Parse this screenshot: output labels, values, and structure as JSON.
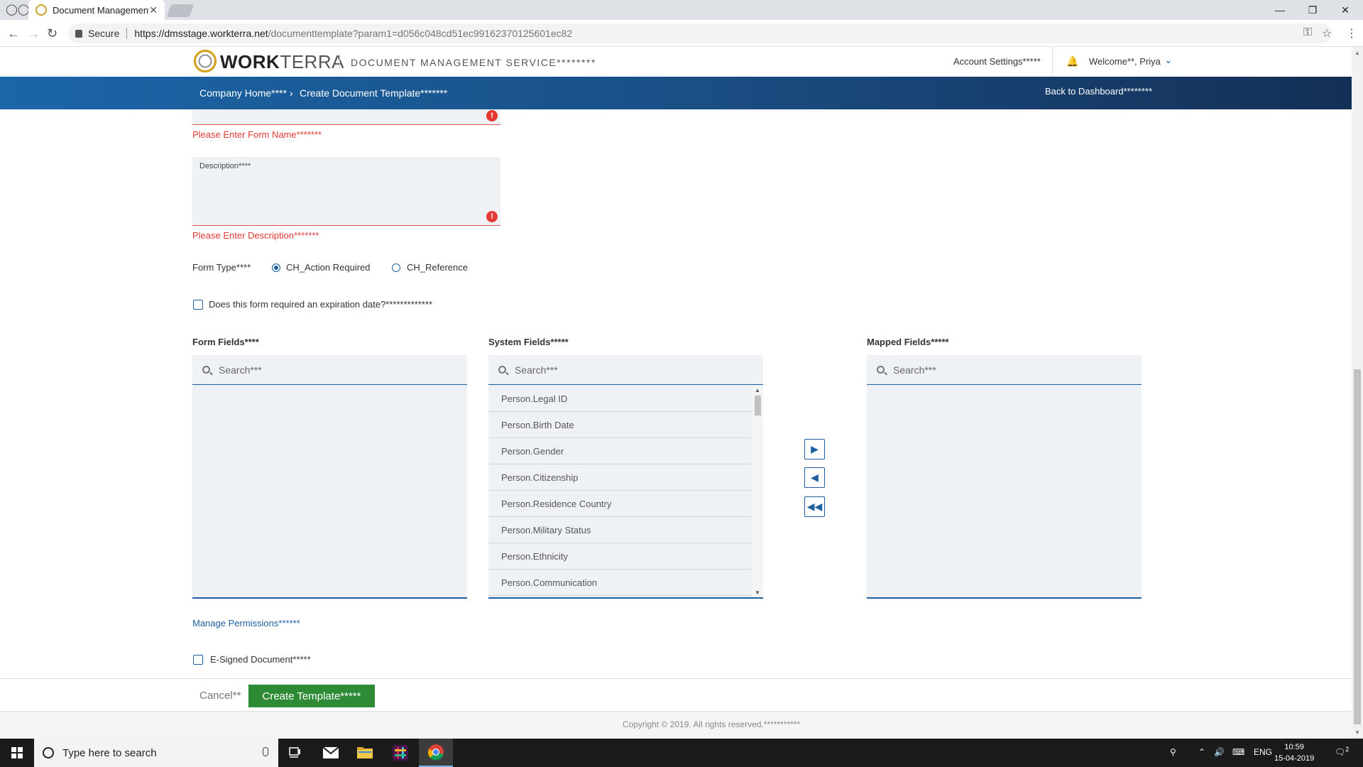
{
  "browser": {
    "tab_title": "Document Management",
    "secure_label": "Secure",
    "url_host": "https://dmsstage.workterra.net",
    "url_path": "/documenttemplate?param1=d056c048cd51ec99162370125601ec82"
  },
  "header": {
    "logo_bold": "WORK",
    "logo_light": "TERRA",
    "app_title": "DOCUMENT MANAGEMENT SERVICE********",
    "account_settings": "Account Settings*****",
    "welcome": "Welcome**, Priya"
  },
  "breadcrumb": {
    "home": "Company Home****",
    "separator": "›",
    "current": "Create Document Template*******",
    "back": "Back to Dashboard********"
  },
  "form": {
    "form_name_error": "Please Enter Form Name*******",
    "description_label": "Description****",
    "description_error": "Please Enter Description*******",
    "form_type_label": "Form Type****",
    "form_type_options": [
      "CH_Action Required",
      "CH_Reference"
    ],
    "form_type_selected": "CH_Action Required",
    "expiration_label": "Does this form required an expiration date?*************",
    "expiration_checked": false
  },
  "fields": {
    "form_fields_title": "Form Fields****",
    "system_fields_title": "System Fields*****",
    "mapped_fields_title": "Mapped Fields*****",
    "search_placeholder": "Search***",
    "system_fields": [
      "Person.Legal ID",
      "Person.Birth Date",
      "Person.Gender",
      "Person.Citizenship",
      "Person.Residence Country",
      "Person.Military Status",
      "Person.Ethnicity",
      "Person.Communication"
    ]
  },
  "permissions": {
    "manage_link": "Manage Permissions******",
    "esigned_label": "E-Signed Document*****",
    "esigned_checked": false
  },
  "actions": {
    "cancel": "Cancel**",
    "create": "Create Template*****"
  },
  "footer": {
    "copyright": "Copyright © 2019. All rights reserved.***********"
  },
  "taskbar": {
    "search_placeholder": "Type here to search",
    "language": "ENG",
    "time": "10:59",
    "date": "15-04-2019",
    "notification_count": "2"
  },
  "colors": {
    "accent": "#1d5fa0",
    "error": "#e53935",
    "create_button": "#2e8b35"
  }
}
